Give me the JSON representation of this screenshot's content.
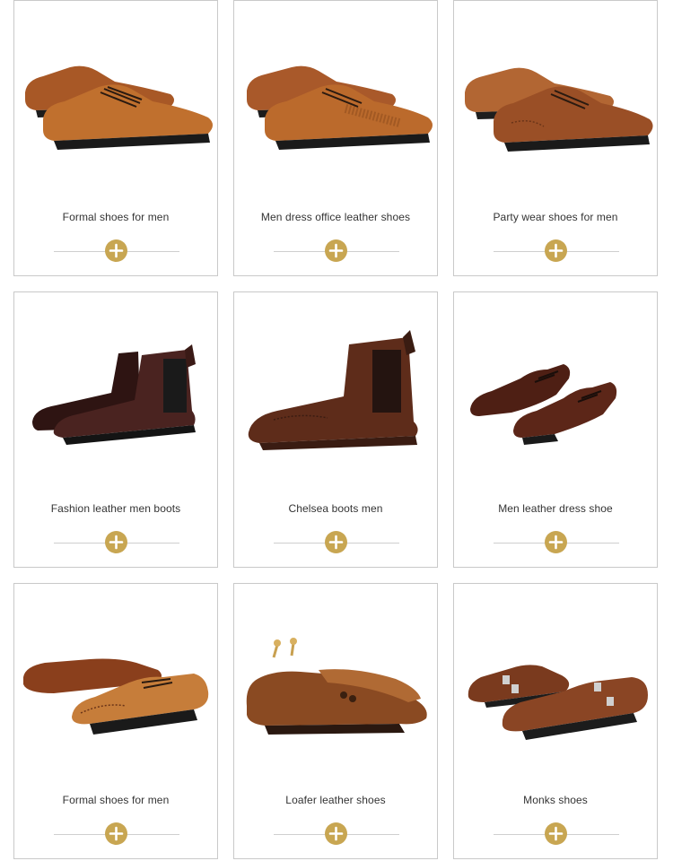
{
  "colors": {
    "accent": "#c8a652",
    "border": "#c9c9c9",
    "text": "#333333",
    "divider": "#cfcfcf"
  },
  "products": [
    {
      "title": "Formal shoes for men",
      "icon": "oxford-cap-toe-pair-icon",
      "leather": "#b8652a"
    },
    {
      "title": "Men dress office leather shoes",
      "icon": "oxford-perforated-pair-icon",
      "leather": "#b5652b"
    },
    {
      "title": "Party wear shoes for men",
      "icon": "oxford-brogue-pair-icon",
      "leather": "#a3542a"
    },
    {
      "title": "Fashion leather men boots",
      "icon": "chelsea-boot-pair-icon",
      "leather": "#3f1d1a"
    },
    {
      "title": "Chelsea boots men",
      "icon": "chelsea-boot-icon",
      "leather": "#5a2a1a"
    },
    {
      "title": "Men leather dress shoe",
      "icon": "wingtip-pair-icon",
      "leather": "#5a2518"
    },
    {
      "title": "Formal shoes for men",
      "icon": "wingtip-brogue-pair-icon",
      "leather": "#a8612c"
    },
    {
      "title": "Loafer leather shoes",
      "icon": "tassel-loafer-pair-icon",
      "leather": "#8a4a22"
    },
    {
      "title": "Monks shoes",
      "icon": "double-monk-strap-pair-icon",
      "leather": "#7a3a1e"
    }
  ]
}
